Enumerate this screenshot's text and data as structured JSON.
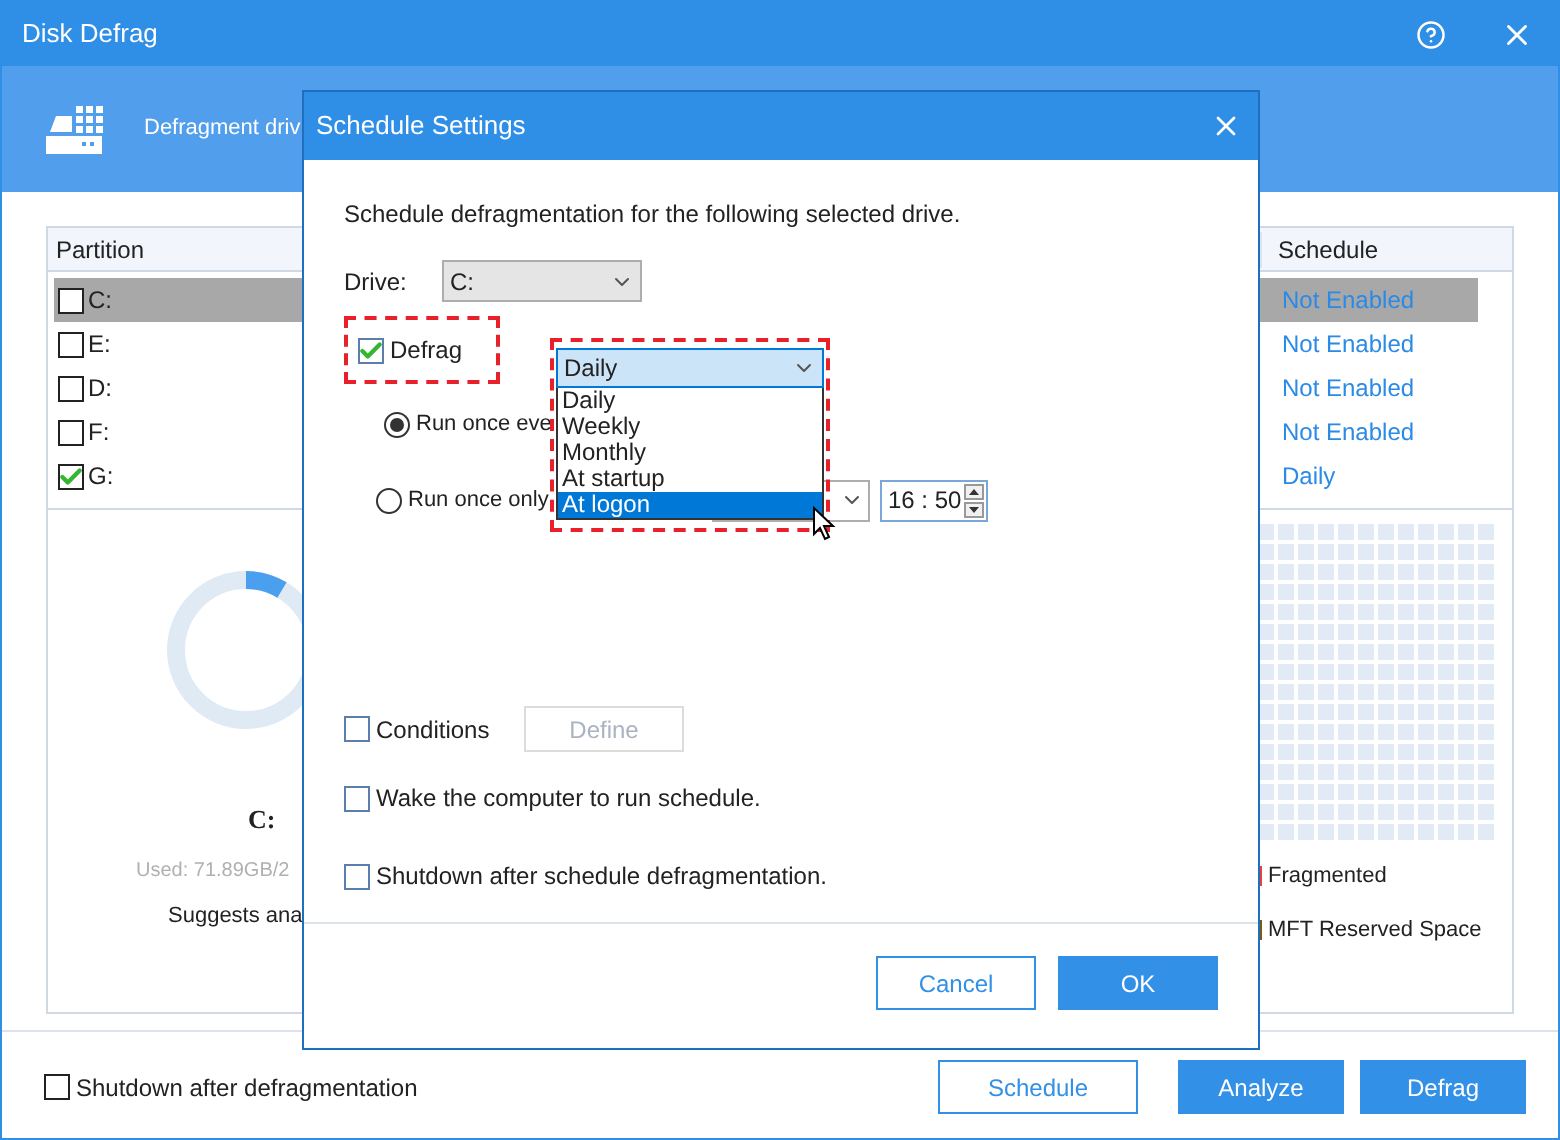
{
  "window": {
    "title": "Disk Defrag"
  },
  "header": {
    "text": "Defragment driv"
  },
  "table": {
    "columns": [
      "Partition",
      "Schedule"
    ],
    "rows": [
      {
        "partition": "C:",
        "checked": false,
        "selected": true,
        "schedule": "Not Enabled"
      },
      {
        "partition": "E:",
        "checked": false,
        "selected": false,
        "schedule": "Not Enabled"
      },
      {
        "partition": "D:",
        "checked": false,
        "selected": false,
        "schedule": "Not Enabled"
      },
      {
        "partition": "F:",
        "checked": false,
        "selected": false,
        "schedule": "Not Enabled"
      },
      {
        "partition": "G:",
        "checked": true,
        "selected": false,
        "schedule": "Daily"
      }
    ]
  },
  "drive_panel": {
    "drive": "C:",
    "used": "Used: 71.89GB/2",
    "suggestion": "Suggests ana",
    "legend": [
      {
        "label": "Fragmented",
        "color": "#e8413a"
      },
      {
        "label": "MFT Reserved Space",
        "color": "#7a5a14"
      }
    ]
  },
  "bottom": {
    "shutdown": {
      "label": "Shutdown after defragmentation",
      "checked": false
    },
    "buttons": [
      {
        "label": "Schedule",
        "kind": "outline"
      },
      {
        "label": "Analyze",
        "kind": "primary"
      },
      {
        "label": "Defrag",
        "kind": "primary"
      }
    ]
  },
  "dialog": {
    "title": "Schedule Settings",
    "intro": "Schedule defragmentation for the following selected drive.",
    "drive": {
      "label": "Drive:",
      "value": "C:"
    },
    "defrag": {
      "label": "Defrag",
      "checked": true
    },
    "frequency": {
      "value": "Daily",
      "options": [
        {
          "label": "Daily",
          "highlighted": false
        },
        {
          "label": "Weekly",
          "highlighted": false
        },
        {
          "label": "Monthly",
          "highlighted": false
        },
        {
          "label": "At startup",
          "highlighted": false
        },
        {
          "label": "At logon",
          "highlighted": true
        }
      ]
    },
    "run_options": [
      {
        "label": "Run once eve",
        "selected": true
      },
      {
        "label": "Run once only",
        "selected": false
      }
    ],
    "time": "16 : 50",
    "conditions": {
      "label": "Conditions",
      "checked": false
    },
    "define_button": {
      "label": "Define",
      "disabled": true
    },
    "wake": {
      "label": "Wake the computer to run schedule.",
      "checked": false
    },
    "shutdown": {
      "label": "Shutdown after schedule defragmentation.",
      "checked": false
    },
    "buttons": [
      {
        "label": "Cancel",
        "kind": "outline"
      },
      {
        "label": "OK",
        "kind": "primary"
      }
    ]
  }
}
